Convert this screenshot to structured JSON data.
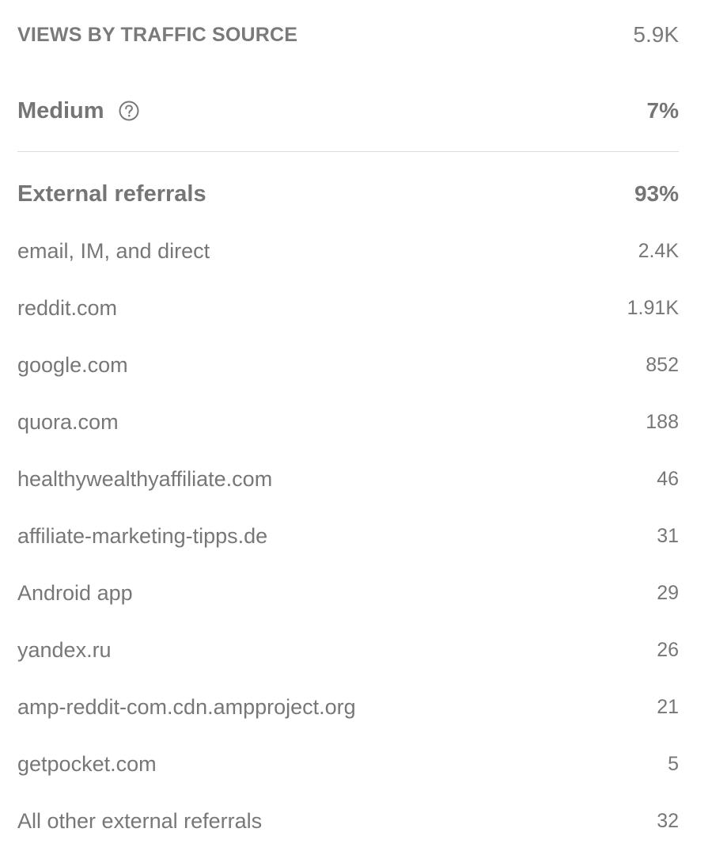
{
  "header": {
    "title": "VIEWS BY TRAFFIC SOURCE",
    "total": "5.9K"
  },
  "medium": {
    "label": "Medium",
    "value": "7%",
    "icon": "help-circle-icon"
  },
  "external": {
    "label": "External referrals",
    "value": "93%"
  },
  "sources": [
    {
      "label": "email, IM, and direct",
      "value": "2.4K"
    },
    {
      "label": "reddit.com",
      "value": "1.91K"
    },
    {
      "label": "google.com",
      "value": "852"
    },
    {
      "label": "quora.com",
      "value": "188"
    },
    {
      "label": "healthywealthyaffiliate.com",
      "value": "46"
    },
    {
      "label": "affiliate-marketing-tipps.de",
      "value": "31"
    },
    {
      "label": "Android app",
      "value": "29"
    },
    {
      "label": "yandex.ru",
      "value": "26"
    },
    {
      "label": "amp-reddit-com.cdn.ampproject.org",
      "value": "21"
    },
    {
      "label": "getpocket.com",
      "value": "5"
    },
    {
      "label": "All other external referrals",
      "value": "32"
    }
  ]
}
